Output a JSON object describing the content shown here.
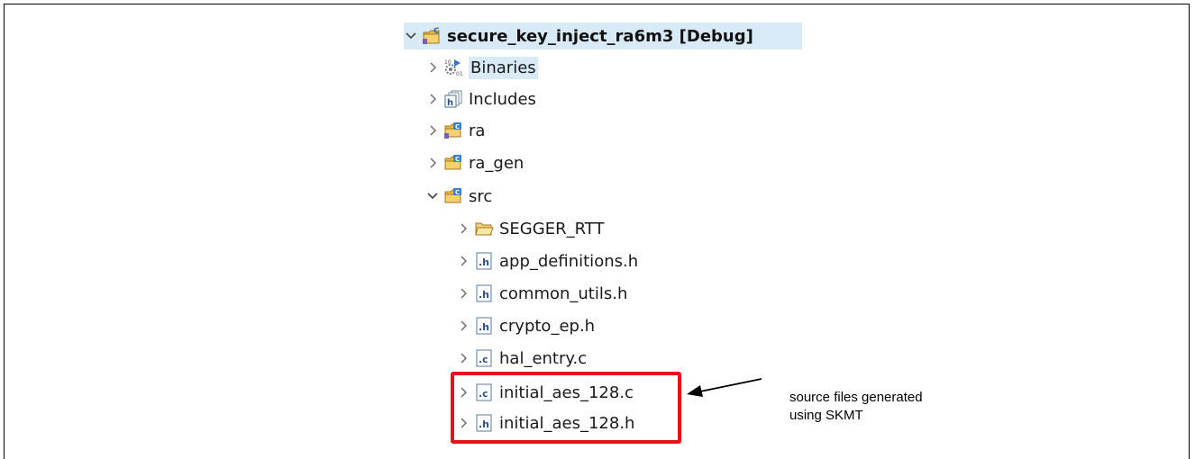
{
  "tree": {
    "project": {
      "label": "secure_key_inject_ra6m3 [Debug]",
      "icon": "c-project-icon",
      "expanded": true
    },
    "children": [
      {
        "label": "Binaries",
        "icon": "binaries-icon",
        "expanded": false
      },
      {
        "label": "Includes",
        "icon": "includes-icon",
        "expanded": false
      },
      {
        "label": "ra",
        "icon": "source-folder-icon",
        "expanded": false
      },
      {
        "label": "ra_gen",
        "icon": "source-folder-icon",
        "expanded": false
      },
      {
        "label": "src",
        "icon": "source-folder-icon",
        "expanded": true
      }
    ],
    "src_children": [
      {
        "label": "SEGGER_RTT",
        "icon": "folder-icon"
      },
      {
        "label": "app_definitions.h",
        "icon": "h-file-icon"
      },
      {
        "label": "common_utils.h",
        "icon": "h-file-icon"
      },
      {
        "label": "crypto_ep.h",
        "icon": "h-file-icon"
      },
      {
        "label": "hal_entry.c",
        "icon": "c-file-icon"
      },
      {
        "label": "initial_aes_128.c",
        "icon": "c-file-icon"
      },
      {
        "label": "initial_aes_128.h",
        "icon": "h-file-icon"
      }
    ]
  },
  "annotation": {
    "line1": "source files generated",
    "line2": "using SKMT"
  },
  "colors": {
    "highlight_border": "#e8111a",
    "selection_bg": "#d9eaf7"
  }
}
